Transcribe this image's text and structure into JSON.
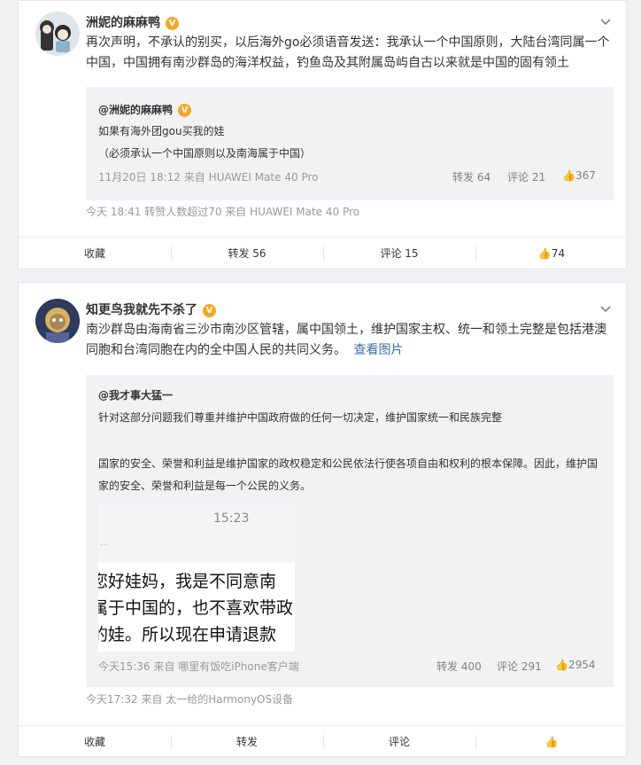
{
  "post1": {
    "username": "洲妮的麻麻鸭",
    "badge": "V",
    "text": "再次声明，不承认的别买，以后海外go必须语音发送：我承认一个中国原则，大陆台湾同属一个中国，中国拥有南沙群岛的海洋权益，钓鱼岛及其附属岛屿自古以来就是中国的固有领土",
    "quote": {
      "author": "@洲妮的麻麻鸭",
      "line1": "如果有海外团gou买我的娃",
      "line2": "（必须承认一个中国原则以及南海属于中国）",
      "meta": "11月20日 18:12 来自 HUAWEI Mate 40 Pro",
      "repost": "转发 64",
      "comment": "评论 21",
      "like": "367"
    },
    "meta": "今天 18:41 转赞人数超过70   来自 HUAWEI Mate 40 Pro",
    "actions": {
      "collect": "收藏",
      "repost": "转发 56",
      "comment": "评论 15",
      "like": "74"
    }
  },
  "post2": {
    "username": "知更鸟我就先不杀了",
    "badge": "V",
    "text": "南沙群岛由海南省三沙市南沙区管辖，属中国领土，维护国家主权、统一和领土完整是包括港澳同胞和台湾同胞在内的全中国人民的共同义务。",
    "view_image": "查看图片",
    "quote": {
      "author": "@我才事大猛一",
      "line1": "针对这部分问题我们尊重并维护中国政府做的任何一切决定，维护国家统一和民族完整",
      "line2": "国家的安全、荣誉和利益是维护国家的政权稳定和公民依法行使各项自由和权利的根本保障。因此，维护国家的安全、荣誉和利益是每一个公民的义务。",
      "image": {
        "time": "15:23",
        "line1": "您好娃妈，我是不同意南",
        "line2": "属于中国的，也不喜欢带政",
        "line3": "的娃。所以现在申请退款"
      },
      "meta": "今天15:36 来自 哪里有饭吃iPhone客户端",
      "repost": "转发 400",
      "comment": "评论 291",
      "like": "2954"
    },
    "meta": "今天17:32 来自 太一给的HarmonyOS设备",
    "actions": {
      "collect": "收藏",
      "repost": "转发",
      "comment": "评论",
      "like": ""
    }
  }
}
